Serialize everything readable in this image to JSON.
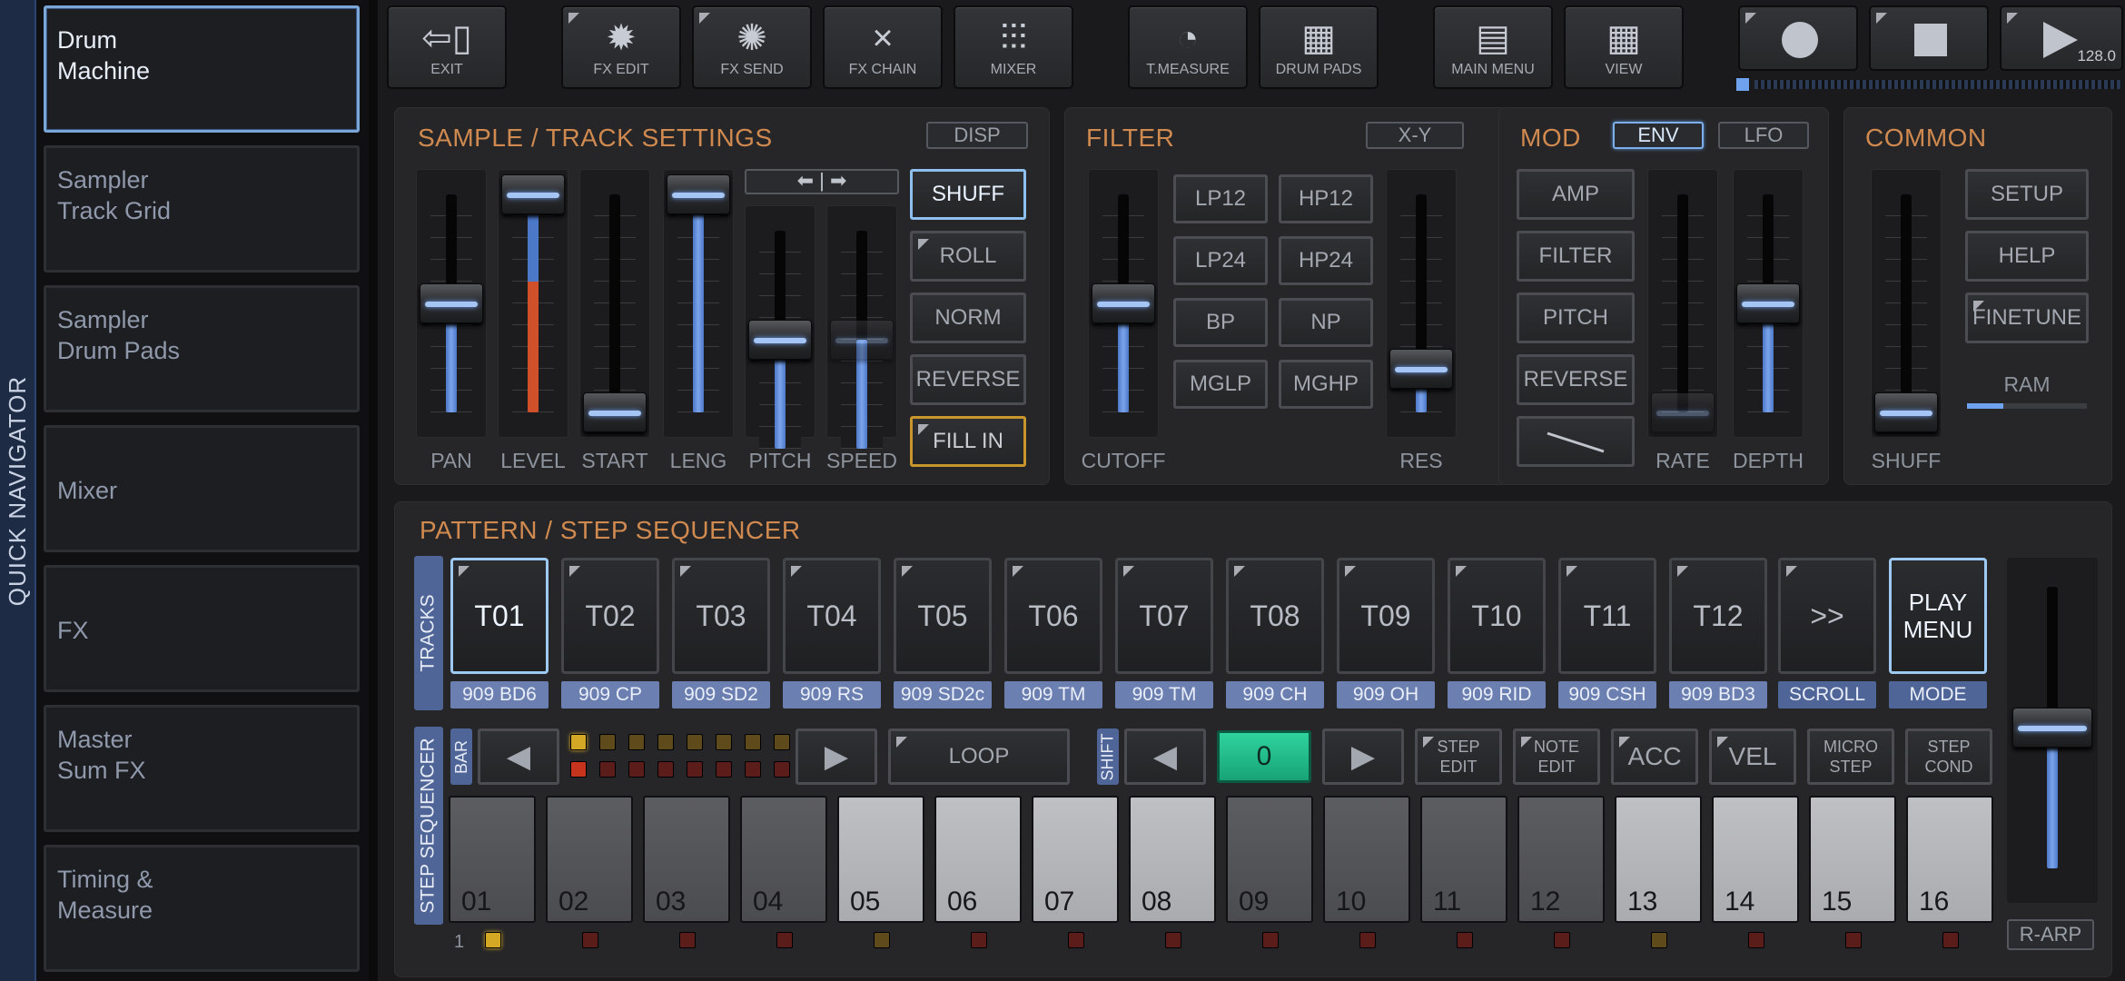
{
  "quick_navigator": {
    "label": "QUICK NAVIGATOR",
    "items": [
      {
        "label": "Drum\nMachine",
        "active": true
      },
      {
        "label": "Sampler\nTrack Grid",
        "active": false
      },
      {
        "label": "Sampler\nDrum Pads",
        "active": false
      },
      {
        "label": "Mixer",
        "active": false
      },
      {
        "label": "FX",
        "active": false
      },
      {
        "label": "Master\nSum FX",
        "active": false
      },
      {
        "label": "Timing &\nMeasure",
        "active": false
      }
    ]
  },
  "toolbar": {
    "exit": {
      "label": "EXIT",
      "icon": "exit-door-icon"
    },
    "fx_edit": {
      "label": "FX EDIT",
      "icon": "fx-sun-icon"
    },
    "fx_send": {
      "label": "FX SEND",
      "icon": "fx-dashed-sun-icon"
    },
    "fx_chain": {
      "label": "FX CHAIN",
      "icon": "close-x-icon"
    },
    "mixer": {
      "label": "MIXER",
      "icon": "mixer-sliders-icon"
    },
    "t_measure": {
      "label": "T.MEASURE",
      "icon": "gauge-icon"
    },
    "drum_pads": {
      "label": "DRUM PADS",
      "icon": "grid-icon"
    },
    "main_menu": {
      "label": "MAIN MENU",
      "icon": "archive-icon"
    },
    "view": {
      "label": "VIEW",
      "icon": "grid-icon"
    },
    "record_icon": "record-icon",
    "stop_icon": "stop-icon",
    "play_icon": "play-icon",
    "tempo": "128.0"
  },
  "sample_track": {
    "title": "SAMPLE / TRACK SETTINGS",
    "disp": "DISP",
    "sliders": [
      {
        "label": "PAN",
        "value": 0.5
      },
      {
        "label": "LEVEL",
        "value": 1.0
      },
      {
        "label": "START",
        "value": 0.0
      },
      {
        "label": "LENG",
        "value": 1.0
      },
      {
        "label": "PITCH",
        "value": 0.5
      },
      {
        "label": "SPEED",
        "value": 0.5
      }
    ],
    "buttons": [
      {
        "label": "SHUFF",
        "state": "on"
      },
      {
        "label": "ROLL",
        "state": "off"
      },
      {
        "label": "NORM",
        "state": "off"
      },
      {
        "label": "REVERSE",
        "state": "off"
      },
      {
        "label": "FILL IN",
        "state": "gold"
      }
    ]
  },
  "filter": {
    "title": "FILTER",
    "xy": "X-Y",
    "cutoff": {
      "label": "CUTOFF",
      "value": 0.5
    },
    "res": {
      "label": "RES",
      "value": 0.2
    },
    "types": [
      "LP12",
      "HP12",
      "LP24",
      "HP24",
      "BP",
      "NP",
      "MGLP",
      "MGHP"
    ]
  },
  "mod": {
    "title": "MOD",
    "env": "ENV",
    "lfo": "LFO",
    "buttons": [
      "AMP",
      "FILTER",
      "PITCH",
      "REVERSE"
    ],
    "rate": {
      "label": "RATE",
      "value": 0.0
    },
    "depth": {
      "label": "DEPTH",
      "value": 0.5
    }
  },
  "common": {
    "title": "COMMON",
    "shuff": {
      "label": "SHUFF",
      "value": 0.0
    },
    "buttons": [
      "SETUP",
      "HELP",
      "FINETUNE"
    ],
    "ram_label": "RAM",
    "ram_value": 0.3
  },
  "sequencer": {
    "title": "PATTERN / STEP SEQUENCER",
    "tracks_label": "TRACKS",
    "tracks": [
      {
        "id": "T01",
        "name": "909 BD6",
        "active": true
      },
      {
        "id": "T02",
        "name": "909 CP",
        "active": false
      },
      {
        "id": "T03",
        "name": "909 SD2",
        "active": false
      },
      {
        "id": "T04",
        "name": "909 RS",
        "active": false
      },
      {
        "id": "T05",
        "name": "909 SD2c",
        "active": false
      },
      {
        "id": "T06",
        "name": "909 TM",
        "active": false
      },
      {
        "id": "T07",
        "name": "909 TM",
        "active": false
      },
      {
        "id": "T08",
        "name": "909 CH",
        "active": false
      },
      {
        "id": "T09",
        "name": "909 OH",
        "active": false
      },
      {
        "id": "T10",
        "name": "909 RID",
        "active": false
      },
      {
        "id": "T11",
        "name": "909 CSH",
        "active": false
      },
      {
        "id": "T12",
        "name": "909 BD3",
        "active": false
      }
    ],
    "scroll": {
      "label": ">>",
      "sub": "SCROLL"
    },
    "mode": {
      "label": "PLAY\nMENU",
      "sub": "MODE"
    },
    "step_label": "STEP SEQUENCER",
    "bar_label": "BAR",
    "loop": "LOOP",
    "shift_label": "SHIFT",
    "shift_value": "0",
    "step_edit": "STEP\nEDIT",
    "note_edit": "NOTE\nEDIT",
    "acc": "ACC",
    "vel": "VEL",
    "micro_step": "MICRO\nSTEP",
    "step_cond": "STEP\nCOND",
    "steps": [
      "01",
      "02",
      "03",
      "04",
      "05",
      "06",
      "07",
      "08",
      "09",
      "10",
      "11",
      "12",
      "13",
      "14",
      "15",
      "16"
    ],
    "bar_number": "1",
    "master_level": 0.5,
    "r_arp": "R-ARP"
  }
}
